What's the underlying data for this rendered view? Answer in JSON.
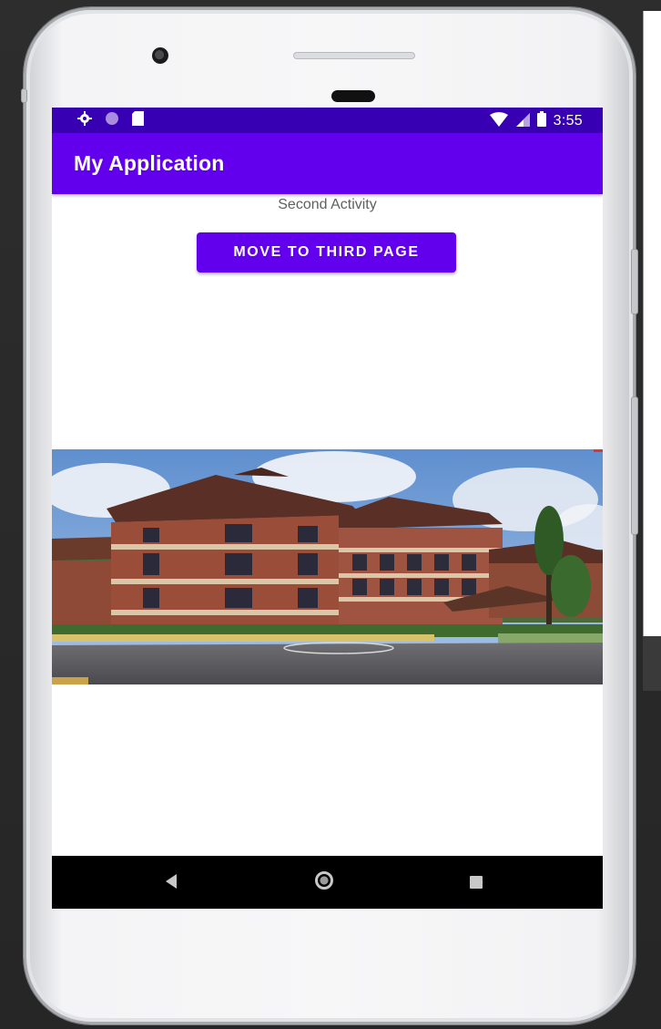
{
  "status_bar": {
    "time": "3:55",
    "icons": [
      "settings-icon",
      "notification-dot-icon",
      "sd-card-icon",
      "wifi-icon",
      "signal-icon",
      "battery-icon"
    ]
  },
  "app_bar": {
    "title": "My Application"
  },
  "content": {
    "activity_label": "Second Activity",
    "button_label": "MOVE TO THIRD PAGE",
    "image_subject": "college-building-photo"
  },
  "navigation_bar": {
    "buttons": [
      "back-icon",
      "home-icon",
      "recents-icon"
    ]
  },
  "colors": {
    "primary": "#6200ee",
    "primary_dark": "#3700b3",
    "background": "#ffffff",
    "nav_bar": "#000000"
  }
}
